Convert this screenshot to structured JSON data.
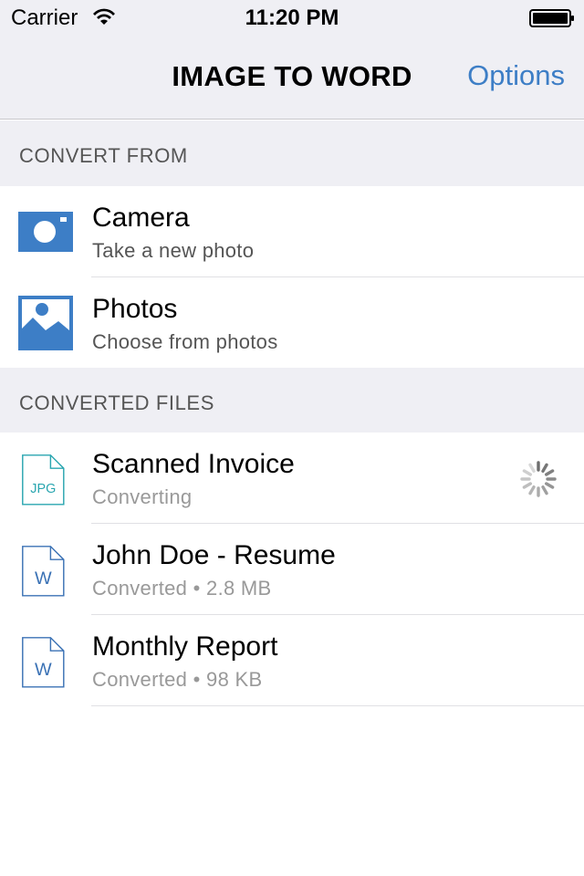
{
  "status_bar": {
    "carrier": "Carrier",
    "time": "11:20 PM"
  },
  "nav": {
    "title": "IMAGE TO WORD",
    "options_label": "Options"
  },
  "colors": {
    "accent": "#3d7ec6",
    "jpg_icon": "#2aa6b0",
    "word_icon": "#3b72b5",
    "header_bg": "#efeff4"
  },
  "convert_from": {
    "header": "CONVERT FROM",
    "items": [
      {
        "title": "Camera",
        "subtitle": "Take a new photo",
        "icon": "camera-icon"
      },
      {
        "title": "Photos",
        "subtitle": "Choose from photos",
        "icon": "photos-icon"
      }
    ]
  },
  "converted_files": {
    "header": "CONVERTED FILES",
    "items": [
      {
        "title": "Scanned Invoice",
        "subtitle": "Converting",
        "icon": "jpg-file-icon",
        "file_label": "JPG",
        "loading": true
      },
      {
        "title": "John Doe - Resume",
        "subtitle": "Converted • 2.8 MB",
        "icon": "word-file-icon",
        "file_label": "W"
      },
      {
        "title": "Monthly Report",
        "subtitle": "Converted • 98 KB",
        "icon": "word-file-icon",
        "file_label": "W"
      }
    ]
  }
}
